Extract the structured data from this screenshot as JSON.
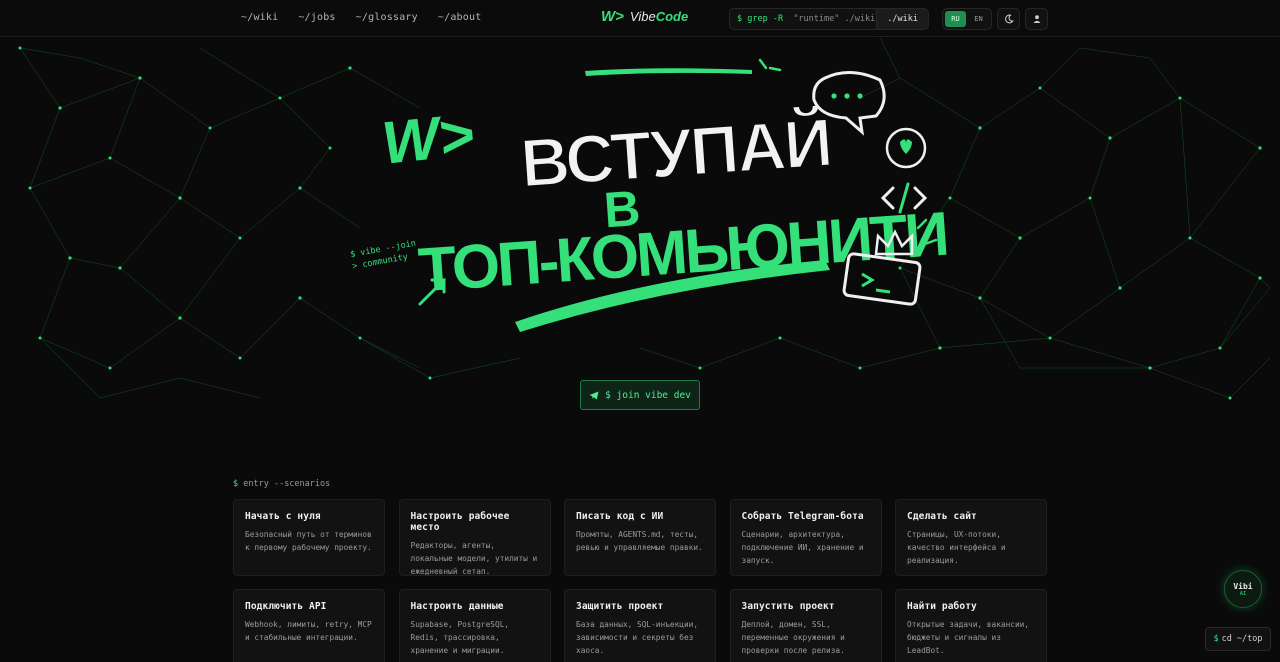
{
  "nav": {
    "items": [
      "~/wiki",
      "~/jobs",
      "~/glossary",
      "~/about"
    ]
  },
  "logo": {
    "mark": "W>",
    "text_a": "Vibe",
    "text_b": "Code"
  },
  "search": {
    "command_prefix": "$ grep -R",
    "query": "\"runtime\" ./wiki",
    "scope_button": "./wiki"
  },
  "lang": {
    "active": "RU",
    "inactive": "EN"
  },
  "icons": {
    "theme": "moon-icon",
    "profile": "user-icon",
    "join": "telegram-icon"
  },
  "hero": {
    "badge": "W>",
    "line1": "ВСТУПАЙ",
    "line2": "В",
    "line3": "ТОП-КОМЬЮНИТИ",
    "terminal_line1": "$ vibe --join",
    "terminal_line2": "> community",
    "join_button": "$ join vibe dev"
  },
  "scenarios": {
    "prompt_symbol": "$",
    "prompt_text": "entry --scenarios",
    "cards": [
      {
        "title": "Начать с нуля",
        "desc": "Безопасный путь от терминов к первому рабочему проекту."
      },
      {
        "title": "Настроить рабочее место",
        "desc": "Редакторы, агенты, локальные модели, утилиты и ежедневный сетап."
      },
      {
        "title": "Писать код с ИИ",
        "desc": "Промпты, AGENTS.md, тесты, ревью и управляемые правки."
      },
      {
        "title": "Собрать Telegram-бота",
        "desc": "Сценарии, архитектура, подключение ИИ, хранение и запуск."
      },
      {
        "title": "Сделать сайт",
        "desc": "Страницы, UX-потоки, качество интерфейса и реализация."
      },
      {
        "title": "Подключить API",
        "desc": "Webhook, лимиты, retry, MCP и стабильные интеграции."
      },
      {
        "title": "Настроить данные",
        "desc": "Supabase, PostgreSQL, Redis, трассировка, хранение и миграции."
      },
      {
        "title": "Защитить проект",
        "desc": "База данных, SQL-инъекции, зависимости и секреты без хаоса."
      },
      {
        "title": "Запустить проект",
        "desc": "Деплой, домен, SSL, переменные окружения и проверки после релиза."
      },
      {
        "title": "Найти работу",
        "desc": "Открытые задачи, вакансии, бюджеты и сигналы из LeadBot."
      }
    ]
  },
  "assistant": {
    "name": "Vibi",
    "tag": "AI"
  },
  "scroll_top": {
    "symbol": "$",
    "label": "cd ~/top"
  },
  "colors": {
    "accent": "#35e07a",
    "background": "#0a0a0a",
    "card": "#121212"
  }
}
